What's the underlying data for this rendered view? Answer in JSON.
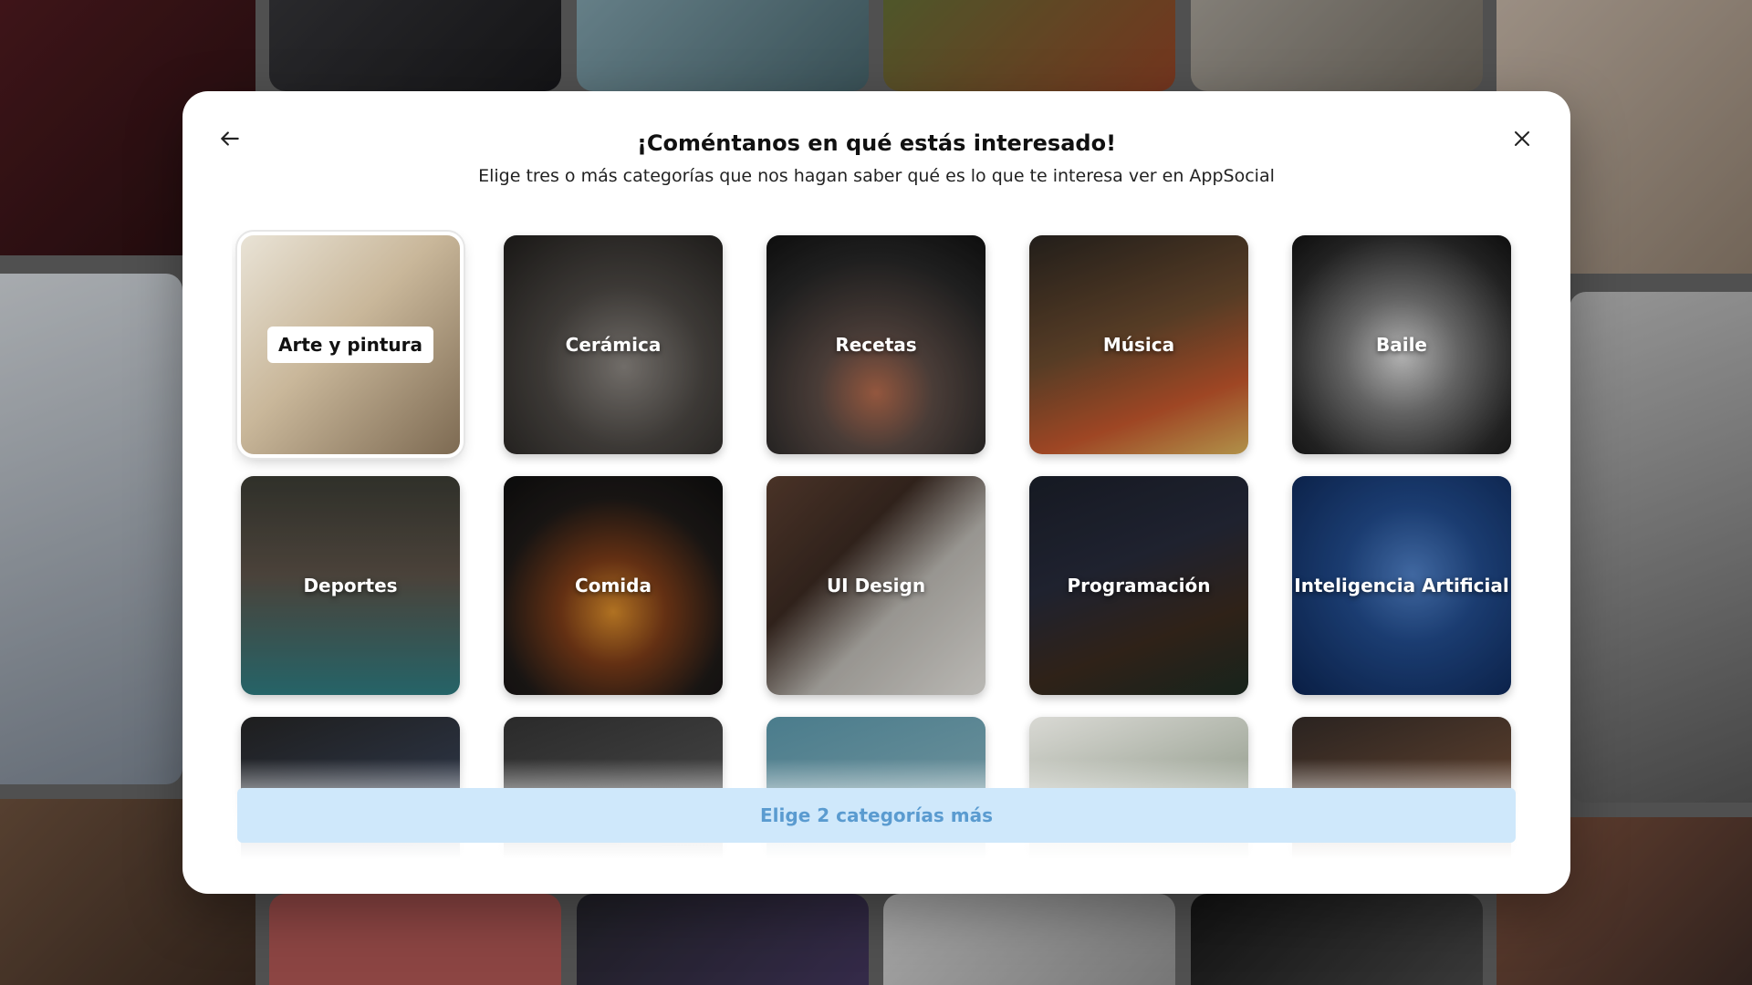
{
  "modal": {
    "title": "¡Coméntanos en qué estás interesado!",
    "subtitle": "Elige tres o más categorías que nos hagan saber qué es lo que te interesa ver en AppSocial",
    "back_icon": "arrow-left-icon",
    "close_icon": "close-icon"
  },
  "categories": [
    {
      "label": "Arte y pintura",
      "selected": true
    },
    {
      "label": "Cerámica",
      "selected": false
    },
    {
      "label": "Recetas",
      "selected": false
    },
    {
      "label": "Música",
      "selected": false
    },
    {
      "label": "Baile",
      "selected": false
    },
    {
      "label": "Deportes",
      "selected": false
    },
    {
      "label": "Comida",
      "selected": false
    },
    {
      "label": "UI Design",
      "selected": false
    },
    {
      "label": "Programación",
      "selected": false
    },
    {
      "label": "Inteligencia Artificial",
      "selected": false
    },
    {
      "label": "",
      "selected": false
    },
    {
      "label": "",
      "selected": false
    },
    {
      "label": "",
      "selected": false
    },
    {
      "label": "",
      "selected": false
    },
    {
      "label": "",
      "selected": false
    }
  ],
  "cta": {
    "label": "Elige 2 categorías más"
  },
  "colors": {
    "cta_bg": "#cfe8fb",
    "cta_text": "#5a9bd0"
  }
}
